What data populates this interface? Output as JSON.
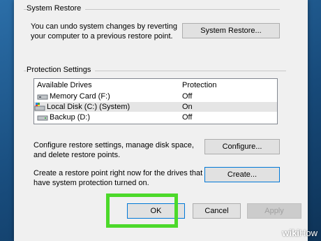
{
  "system_restore": {
    "group_title": "System Restore",
    "description": "You can undo system changes by reverting your computer to a previous restore point.",
    "button_label": "System Restore..."
  },
  "protection": {
    "group_title": "Protection Settings",
    "columns": {
      "drives": "Available Drives",
      "protection": "Protection"
    },
    "drives": [
      {
        "name": "Memory Card (F:)",
        "status": "Off",
        "icon": "removable-drive-icon",
        "selected": false
      },
      {
        "name": "Local Disk (C:) (System)",
        "status": "On",
        "icon": "system-drive-icon",
        "selected": true
      },
      {
        "name": "Backup (D:)",
        "status": "Off",
        "icon": "drive-icon",
        "selected": false
      }
    ],
    "configure_text": "Configure restore settings, manage disk space, and delete restore points.",
    "configure_label": "Configure...",
    "create_text": "Create a restore point right now for the drives that have system protection turned on.",
    "create_label": "Create..."
  },
  "footer": {
    "ok_label": "OK",
    "cancel_label": "Cancel",
    "apply_label": "Apply"
  },
  "watermark": {
    "bold": "wiki",
    "light": "How"
  },
  "colors": {
    "highlight": "#4cd92a",
    "focus_border": "#0078d7",
    "dialog_bg": "#f0f0f0"
  }
}
